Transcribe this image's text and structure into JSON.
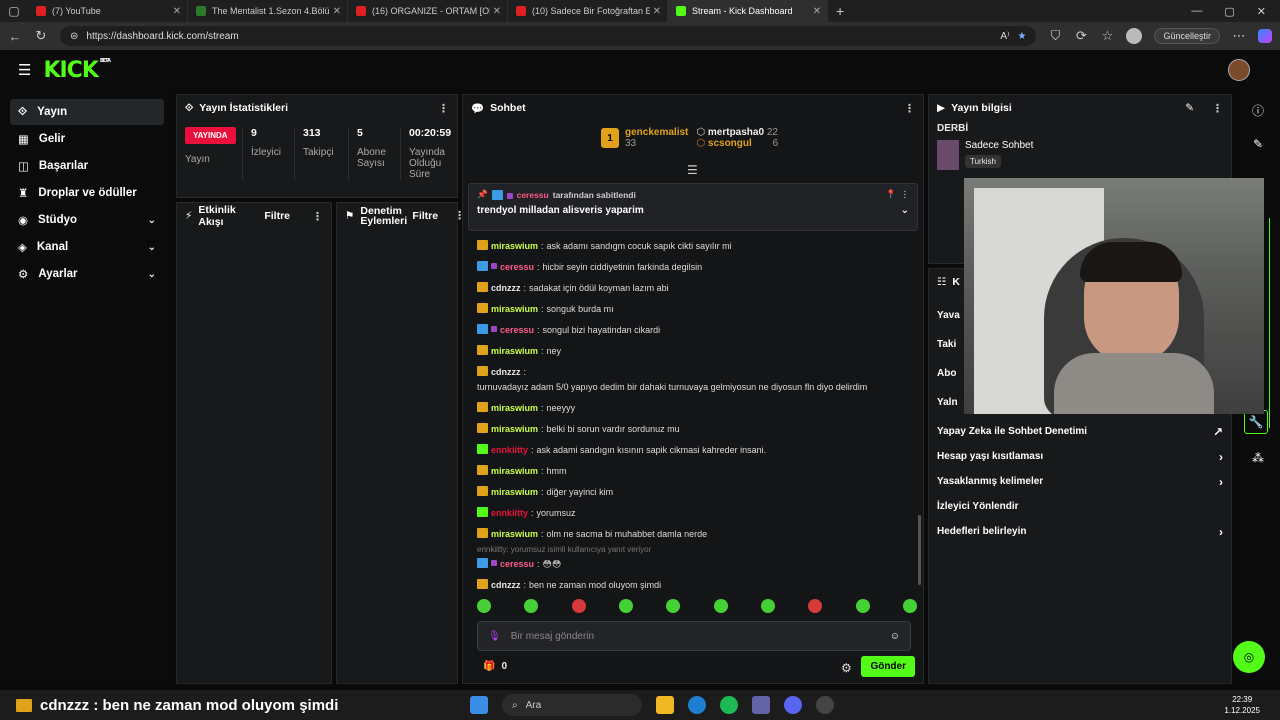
{
  "browser": {
    "tabs": [
      {
        "label": "(7) YouTube",
        "color": "#e02020"
      },
      {
        "label": "The Mentalist 1.Sezon 4.Bölüm - F",
        "color": "#2a7a2a"
      },
      {
        "label": "(16) ORGANIZE - ORTAM [OFFICIA",
        "color": "#e02020"
      },
      {
        "label": "(10) Sadece Bir Fotoğraftan En Fa",
        "color": "#e02020"
      },
      {
        "label": "Stream - Kick Dashboard",
        "color": "#53fc18"
      }
    ],
    "url": "https://dashboard.kick.com/stream",
    "update_label": "Güncelleştir"
  },
  "brand": {
    "logo": "KICK",
    "beta": "BETA",
    "accent": "#53fc18"
  },
  "sidebar": {
    "items": [
      {
        "label": "Yayın",
        "icon": "broadcast-icon"
      },
      {
        "label": "Gelir",
        "icon": "revenue-icon"
      },
      {
        "label": "Başarılar",
        "icon": "achievements-icon"
      },
      {
        "label": "Droplar ve ödüller",
        "icon": "trophy-icon"
      },
      {
        "label": "Stüdyo",
        "icon": "studio-icon"
      },
      {
        "label": "Kanal",
        "icon": "channel-icon"
      },
      {
        "label": "Ayarlar",
        "icon": "settings-icon"
      }
    ]
  },
  "stats": {
    "title": "Yayın İstatistikleri",
    "live": "YAYINDA",
    "live_label": "Yayın",
    "items": [
      {
        "value": "9",
        "label": "İzleyici"
      },
      {
        "value": "313",
        "label": "Takipçi"
      },
      {
        "value": "5",
        "label": "Abone Sayısı"
      },
      {
        "value": "00:20:59",
        "label": "Yayında Olduğu Süre"
      }
    ]
  },
  "activity": {
    "title": "Etkinlik Akışı",
    "filter": "Filtre"
  },
  "moderation": {
    "title": "Denetim Eylemleri",
    "filter": "Filtre"
  },
  "chat": {
    "title": "Sohbet",
    "leaders": [
      {
        "rank": "1",
        "name": "genckemalist",
        "value": "33"
      },
      {
        "name": "mertpasha0",
        "value": "22"
      },
      {
        "name": "scsongul",
        "value": "6"
      }
    ],
    "pinned": {
      "by": "ceressu",
      "by_text": "tarafından sabitlendi",
      "text": "trendyol milladan alisveris yaparim"
    },
    "messages": [
      {
        "user": "miraswium",
        "cls": "m",
        "badge": "crown",
        "text": "ask adamı sandıgm cocuk sapık cikti sayılır mi"
      },
      {
        "user": "ceressu",
        "cls": "r",
        "badge": "mod",
        "text": "hicbir seyin ciddiyetinin farkinda degilsin"
      },
      {
        "user": "cdnzzz",
        "cls": "c",
        "badge": "crown",
        "text": "sadakat için ödül koyman lazım abi"
      },
      {
        "user": "miraswium",
        "cls": "m",
        "badge": "crown",
        "text": "songuk burda mı"
      },
      {
        "user": "ceressu",
        "cls": "r",
        "badge": "mod",
        "text": "songul bizi hayatindan cikardi"
      },
      {
        "user": "miraswium",
        "cls": "m",
        "badge": "crown",
        "text": "ney"
      },
      {
        "user": "cdnzzz",
        "cls": "c",
        "badge": "crown",
        "text": "turnuvadayız adam 5/0 yapıyo dedim bir dahaki turnuvaya gelmiyosun ne diyosun fln diyo delirdim"
      },
      {
        "user": "miraswium",
        "cls": "m",
        "badge": "crown",
        "text": "neeyyy"
      },
      {
        "user": "miraswium",
        "cls": "m",
        "badge": "crown",
        "text": "belki bi sorun vardır sordunuz mu"
      },
      {
        "user": "ennkiitty",
        "cls": "e",
        "badge": "green",
        "text": "ask adami sandıgın kısının sapik cikmasi kahreder insani."
      },
      {
        "user": "miraswium",
        "cls": "m",
        "badge": "crown",
        "text": "hmm"
      },
      {
        "user": "miraswium",
        "cls": "m",
        "badge": "crown",
        "text": "diğer yayinci kim"
      },
      {
        "user": "ennkiitty",
        "cls": "e",
        "badge": "green",
        "text": "yorumsuz"
      },
      {
        "user": "miraswium",
        "cls": "m",
        "badge": "crown",
        "text": "olm ne sacma bi muhabbet damla nerde"
      }
    ],
    "reply_note": "ennkiitty: yorumsuz isimli kullanıcıya yanıt veriyor",
    "reply_msgs": [
      {
        "user": "ceressu",
        "cls": "r",
        "badge": "mod",
        "text": "😳😳"
      },
      {
        "user": "cdnzzz",
        "cls": "c",
        "badge": "crown",
        "text": "ben ne zaman mod oluyom şimdi"
      }
    ],
    "input_placeholder": "Bir mesaj gönderin",
    "points": "0",
    "send": "Gönder"
  },
  "streaminfo": {
    "title": "Yayın bilgisi",
    "category": "DERBİ",
    "stream_title": "Sadece Sohbet",
    "language": "Turkish",
    "settings": [
      {
        "label": "Yapay Zeka ile Sohbet Denetimi",
        "end": "↗"
      },
      {
        "label": "Hesap yaşı kısıtlaması",
        "end": "›"
      },
      {
        "label": "Yasaklanmış kelimeler",
        "end": "›"
      },
      {
        "label": "İzleyici Yönlendir",
        "end": ""
      },
      {
        "label": "Hedefleri belirleyin",
        "end": "›"
      }
    ],
    "partial_rows": [
      "Yava",
      "Taki",
      "Abo",
      "Yaln"
    ],
    "partial_head": "K"
  },
  "taskbar": {
    "ticker": "cdnzzz : ben ne zaman mod oluyom şimdi",
    "search": "Ara",
    "time": "22:39",
    "date": "1.12.2025"
  }
}
